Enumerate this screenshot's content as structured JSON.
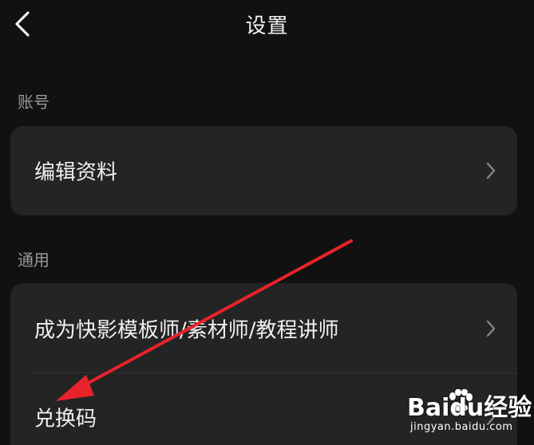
{
  "header": {
    "title": "设置",
    "back_icon": "chevron-left-icon"
  },
  "sections": [
    {
      "label": "账号",
      "items": [
        {
          "label": "编辑资料",
          "icon": "chevron-right-icon"
        }
      ]
    },
    {
      "label": "通用",
      "items": [
        {
          "label": "成为快影模板师/素材师/教程讲师",
          "icon": "chevron-right-icon"
        },
        {
          "label": "兑换码",
          "icon": "chevron-right-icon"
        }
      ]
    }
  ],
  "annotation": {
    "arrow_color": "#e8232b",
    "points_to": "兑换码"
  },
  "watermark": {
    "logo_text": "Baidu经验",
    "url": "jingyan.baidu.com"
  },
  "colors": {
    "background": "#111111",
    "card": "#242424",
    "text": "#f0f0f0",
    "section_label": "#9a9a9a"
  }
}
